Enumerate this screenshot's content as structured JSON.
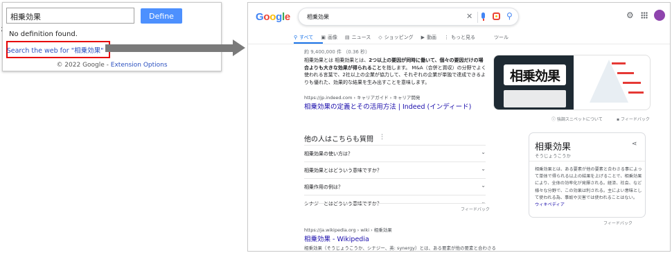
{
  "popup": {
    "query": "相乗効果",
    "define_label": "Define",
    "message": "No definition found.",
    "search_link": "Search the web for \"相乗効果\" »",
    "footer_prefix": "© 2022 Google - ",
    "footer_link": "Extension Options",
    "highlight_color": "#e60000"
  },
  "serp": {
    "logo": "Google",
    "query": "相乗効果",
    "tabs": [
      {
        "icon": "search-icon",
        "label": "すべて",
        "active": true
      },
      {
        "icon": "image-icon",
        "label": "画像"
      },
      {
        "icon": "news-icon",
        "label": "ニュース"
      },
      {
        "icon": "tag-icon",
        "label": "ショッピング"
      },
      {
        "icon": "video-icon",
        "label": "動画"
      },
      {
        "icon": "more-icon",
        "label": "もっと見る"
      },
      {
        "icon": "",
        "label": "ツール"
      }
    ],
    "stats": "約 9,400,000 件 （0.36 秒）",
    "snippet_plain_1": "相乗効果とは 相乗効果とは、",
    "snippet_bold": "2つ以上の要因が同時に働いて、個々の要因だけの場合よりも大きな効果が得られること",
    "snippet_plain_2": "を指します。 M&A（合併と買収）の分野でよく使われる言葉で、2社以上の企業が協力して、それぞれの企業が単独で達成できるよりも優れた、効果的な結果を生み出すことを意味します。",
    "featured_image_title": "相乗効果",
    "source_1": "https://jp.indeed.com › キャリアガイド › キャリア開発",
    "result_1_title": "相乗効果の定義とその活用方法 | Indeed (インディード)",
    "about_snippets": "強調スニペットについて",
    "feedback": "フィードバック",
    "paa_title": "他の人はこちらも質問",
    "paa": [
      "相乗効果の使い方は？",
      "相乗効果とはどういう意味ですか？",
      "相乗作用の例は？",
      "シナジーとはどういう意味ですか？"
    ],
    "source_2": "https://ja.wikipedia.org › wiki › 相乗効果",
    "result_2_title": "相乗効果 - Wikipedia",
    "result_2_snippet": "相乗効果（そうじょうこうか、シナジー、英: synergy）とは、ある要素が他の要素と合わさる",
    "kp": {
      "title": "相乗効果",
      "reading": "そうじょうこうか",
      "description": "相乗効果とは、ある要素が他の要素と合わさる事によって単体で得られる以上の結果を上げることで、相乗効果により、全体の効率化が発揮される。経済、社会、など様々な分野で、この効果は利される。主によい意味として使われる為、事故や災害では使われることはない。",
      "wiki_link": "ウィキペディア"
    }
  },
  "colors": {
    "blue": "#4285f4",
    "red": "#ea4335",
    "yellow": "#fbbc05",
    "green": "#34a853",
    "link": "#1a0dab",
    "arrow": "#7a7a7a"
  }
}
